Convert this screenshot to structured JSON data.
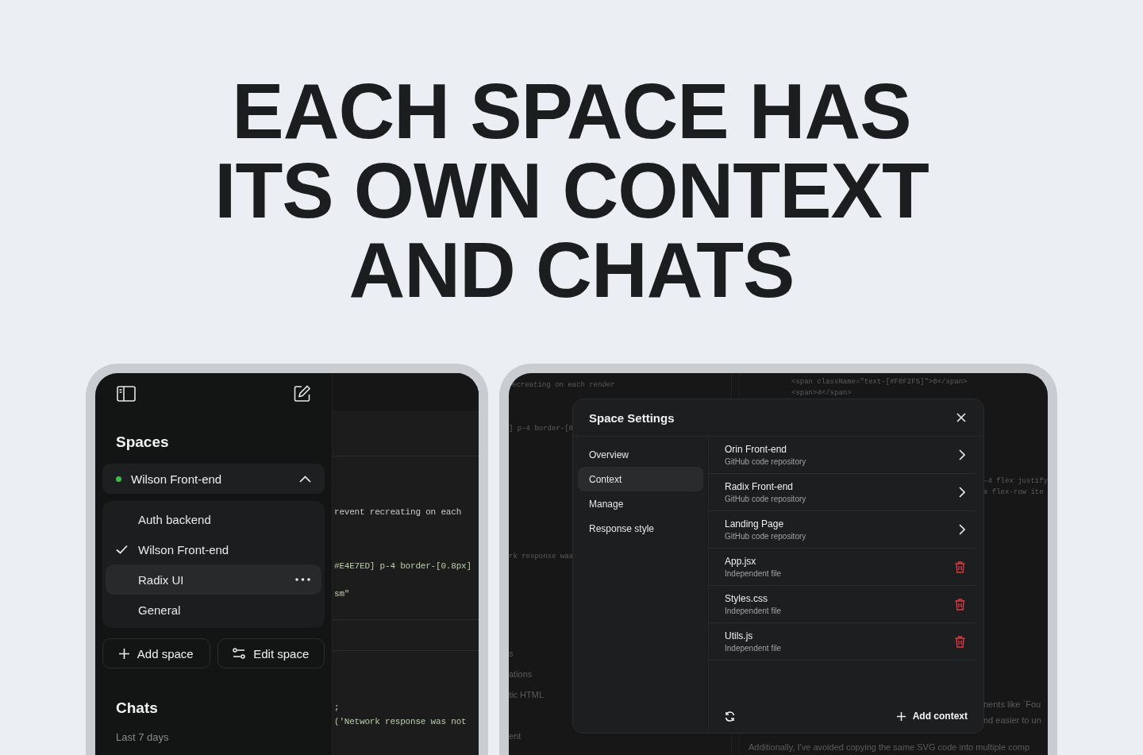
{
  "headline": [
    "EACH SPACE HAS",
    "ITS OWN CONTEXT",
    "AND CHATS"
  ],
  "sidebar": {
    "spaces_title": "Spaces",
    "current_space": {
      "name": "Wilson Front-end",
      "expanded": true
    },
    "space_list": [
      {
        "name": "Auth backend",
        "checked": false,
        "highlighted": false
      },
      {
        "name": "Wilson Front-end",
        "checked": true,
        "highlighted": false
      },
      {
        "name": "Radix UI",
        "checked": false,
        "highlighted": true
      },
      {
        "name": "General",
        "checked": false,
        "highlighted": false
      }
    ],
    "buttons": [
      {
        "label": "Add space",
        "kind": "add"
      },
      {
        "label": "Edit space",
        "kind": "edit"
      }
    ],
    "chats_title": "Chats",
    "chats_group": "Last 7 days"
  },
  "left_code": [
    {
      "text": "revent recreating on each",
      "kind": "plain"
    },
    {
      "text": "#E4E7ED] p-4 border-[0.8px]",
      "kind": "string"
    },
    {
      "text": "sm\"",
      "kind": "string"
    },
    {
      "text": ";",
      "kind": "plain"
    },
    {
      "text": "('Network response was not",
      "kind": "string"
    }
  ],
  "background_text": [
    {
      "text": "ecreating on each render",
      "kind": "code"
    },
    {
      "text": "] p-4 border-[0",
      "kind": "code"
    },
    {
      "text": "rk response was",
      "kind": "code"
    },
    {
      "text": "s",
      "kind": "prose"
    },
    {
      "text": "ations",
      "kind": "prose"
    },
    {
      "text": "tic HTML",
      "kind": "prose"
    },
    {
      "text": "ent",
      "kind": "prose"
    },
    {
      "text": "<span className=\"text-[#F0F2F5]\">0</span>",
      "kind": "code"
    },
    {
      "text": "<span>4</span>",
      "kind": "code"
    },
    {
      "text": "-4 flex justify",
      "kind": "code"
    },
    {
      "text": "x flex-row ite",
      "kind": "code"
    },
    {
      "text": "nents like `Fou",
      "kind": "prose"
    },
    {
      "text": "nd easier to un",
      "kind": "prose"
    },
    {
      "text": "Additionally, I've avoided copying the same SVG code into multiple comp",
      "kind": "prose"
    }
  ],
  "settings": {
    "title": "Space Settings",
    "nav": [
      {
        "label": "Overview",
        "selected": false
      },
      {
        "label": "Context",
        "selected": true
      },
      {
        "label": "Manage",
        "selected": false
      },
      {
        "label": "Response style",
        "selected": false
      }
    ],
    "items": [
      {
        "name": "Orin Front-end",
        "detail": "GitHub code repository",
        "kind": "repository"
      },
      {
        "name": "Radix Front-end",
        "detail": "GitHub code repository",
        "kind": "repository"
      },
      {
        "name": "Landing Page",
        "detail": "GitHub code repository",
        "kind": "repository"
      },
      {
        "name": "App.jsx",
        "detail": "Independent file",
        "kind": "file"
      },
      {
        "name": "Styles.css",
        "detail": "Independent file",
        "kind": "file"
      },
      {
        "name": "Utils.js",
        "detail": "Independent file",
        "kind": "file"
      }
    ],
    "add_label": "Add context"
  }
}
